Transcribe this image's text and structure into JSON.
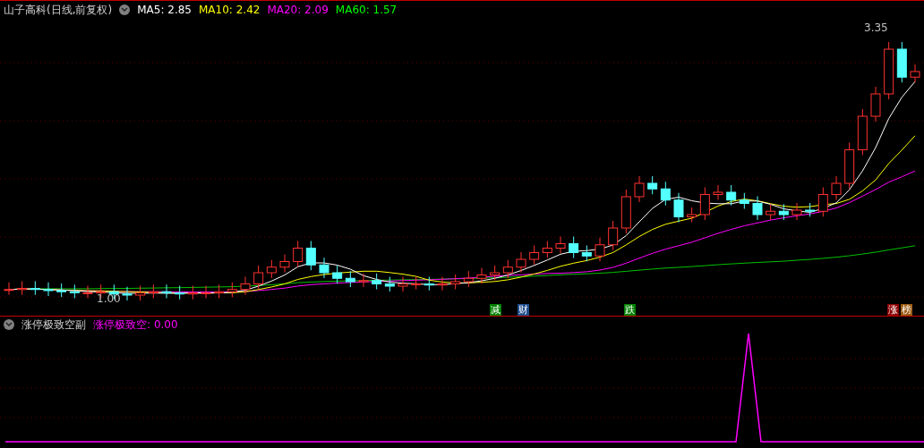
{
  "main_panel": {
    "title": "山子高科(日线,前复权)",
    "indicators": [
      {
        "label": "MA5:",
        "value": "2.85",
        "color": "#ffffff"
      },
      {
        "label": "MA10:",
        "value": "2.42",
        "color": "#ffff00"
      },
      {
        "label": "MA20:",
        "value": "2.09",
        "color": "#ff00ff"
      },
      {
        "label": "MA60:",
        "value": "1.57",
        "color": "#00ff00"
      }
    ],
    "high_label": "3.35",
    "low_label": "1.00",
    "markers": [
      {
        "text": "减",
        "color": "#008000"
      },
      {
        "text": "财",
        "color": "#1f4e8c"
      },
      {
        "text": "跌",
        "color": "#008000"
      },
      {
        "text": "涨",
        "color": "#8b0000"
      },
      {
        "text": "榜",
        "color": "#9a5a10"
      }
    ]
  },
  "sub_panel": {
    "title": "涨停极致空副",
    "indicator": {
      "label": "涨停极致空:",
      "value": "0.00",
      "color": "#ff00ff"
    }
  }
}
